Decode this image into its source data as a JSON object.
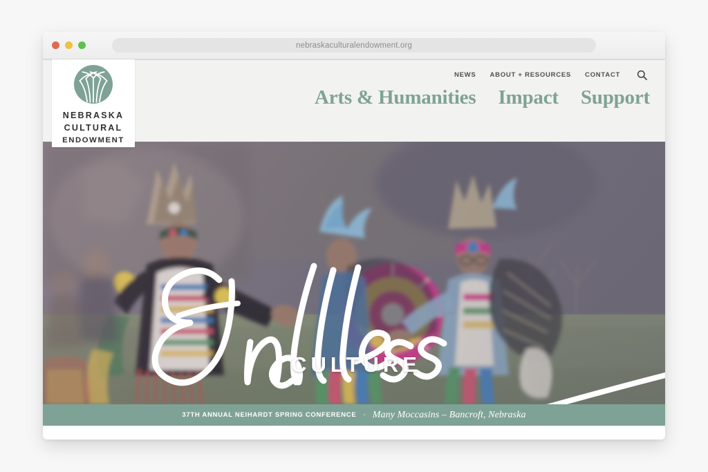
{
  "browser": {
    "url": "nebraskaculturalendowment.org",
    "traffic_lights": [
      {
        "name": "close",
        "color": "#e2694f"
      },
      {
        "name": "minimize",
        "color": "#f0c040"
      },
      {
        "name": "maximize",
        "color": "#5fc04f"
      }
    ]
  },
  "site": {
    "logo": {
      "icon": "woven-prairie-grass-circle-icon",
      "mark_color": "#7fa296",
      "line1": "NEBRASKA",
      "line2": "CULTURAL",
      "line3": "ENDOWMENT"
    },
    "top_nav": [
      {
        "label": "NEWS"
      },
      {
        "label": "ABOUT + RESOURCES"
      },
      {
        "label": "CONTACT"
      }
    ],
    "search_icon": "search-icon",
    "main_nav": [
      {
        "label": "Arts & Humanities"
      },
      {
        "label": "Impact"
      },
      {
        "label": "Support"
      }
    ],
    "accent_green": "#7fa296",
    "header_bg": "#f2f2f0"
  },
  "hero": {
    "script_word": "Endless",
    "sub_word": "CULTURE",
    "image_description": "Native American powwow dancers in colorful regalia on grass"
  },
  "caption": {
    "title": "37TH ANNUAL NEIHARDT SPRING CONFERENCE",
    "separator": "-",
    "subtitle": "Many Moccasins – Bancroft, Nebraska"
  }
}
